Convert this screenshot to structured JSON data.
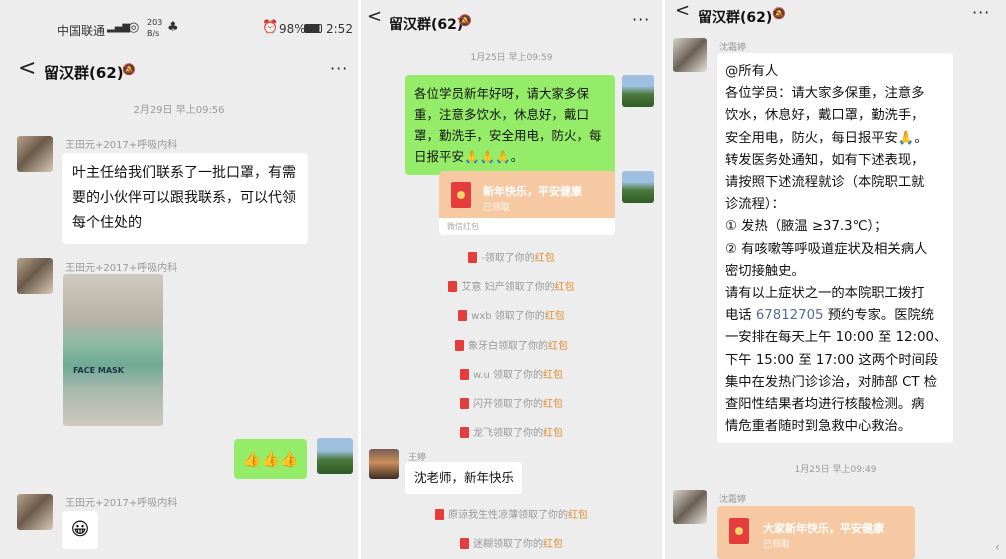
{
  "status_bar": {
    "carrier": "中国联通",
    "net_speed": "203",
    "net_unit": "B/s",
    "battery": "98%",
    "time": "2:52"
  },
  "chat": {
    "title": "留汉群(62)",
    "more": "···"
  },
  "panel1": {
    "time1": "2月29日 早上09:56",
    "sender1": "王田元+2017+呼吸内科",
    "msg1": "叶主任给我们联系了一批口罩，有需要的小伙伴可以跟我联系，可以代领每个住处的",
    "sender2": "王田元+2017+呼吸内科",
    "image_text": "FACE MASK",
    "my_msg": "👍👍👍",
    "sender3": "王田元+2017+呼吸内科",
    "emoji": "😀"
  },
  "panel2": {
    "time1": "1月25日 早上09:59",
    "my_msg": "各位学员新年好呀，请大家多保重，注意多饮水，休息好，戴口罩，勤洗手，安全用电，防火，每日报平安🙏🙏🙏。",
    "red_packet": {
      "title": "新年快乐，平安健康",
      "status": "已领取",
      "footer": "微信红包"
    },
    "claims": [
      {
        "name": "",
        "text": "-领取了你的",
        "hb": "红包"
      },
      {
        "name": "艾意 妇产",
        "text": "领取了你的",
        "hb": "红包"
      },
      {
        "name": "wxb",
        "text": " 领取了你的",
        "hb": "红包"
      },
      {
        "name": "象牙白",
        "text": "领取了你的",
        "hb": "红包"
      },
      {
        "name": "w.u",
        "text": " 领取了你的",
        "hb": "红包"
      },
      {
        "name": "闪开",
        "text": "领取了你的",
        "hb": "红包"
      },
      {
        "name": "龙飞",
        "text": "领取了你的",
        "hb": "红包"
      }
    ],
    "sender": "王婷",
    "msg": "沈老师，新年快乐",
    "claims2": [
      {
        "name": "原谅我生性凉薄",
        "text": "领取了你的",
        "hb": "红包"
      },
      {
        "name": "迷糊",
        "text": "领取了你的",
        "hb": "红包"
      }
    ]
  },
  "panel3": {
    "sender1": "沈霜婷",
    "msg_lines": [
      "@所有人",
      "各位学员：请大家多保重，注意多",
      "饮水，休息好，戴口罩，勤洗手，",
      "安全用电，防火，每日报平安🙏。",
      "转发医务处通知，如有下述表现，",
      "请按照下述流程就诊（本院职工就",
      "诊流程）：",
      "① 发热（腋温 ≥37.3℃）；",
      "② 有咳嗽等呼吸道症状及相关病人",
      "密切接触史。",
      "请有以上症状之一的本院职工拨打",
      "电话",
      "一安排在每天上午 10:00 至 12:00、",
      "下午 15:00 至 17:00 这两个时间段",
      "集中在发热门诊诊治，对肺部 CT 检",
      "查阳性结果者均进行核酸检测。病",
      "情危重者随时到急救中心救治。"
    ],
    "phone": "67812705",
    "phone_after": " 预约专家。医院统",
    "time2": "1月25日 早上09:49",
    "sender2": "沈霜婷",
    "red_packet": {
      "title": "大家新年快乐，平安健康",
      "status": "已领取"
    }
  }
}
